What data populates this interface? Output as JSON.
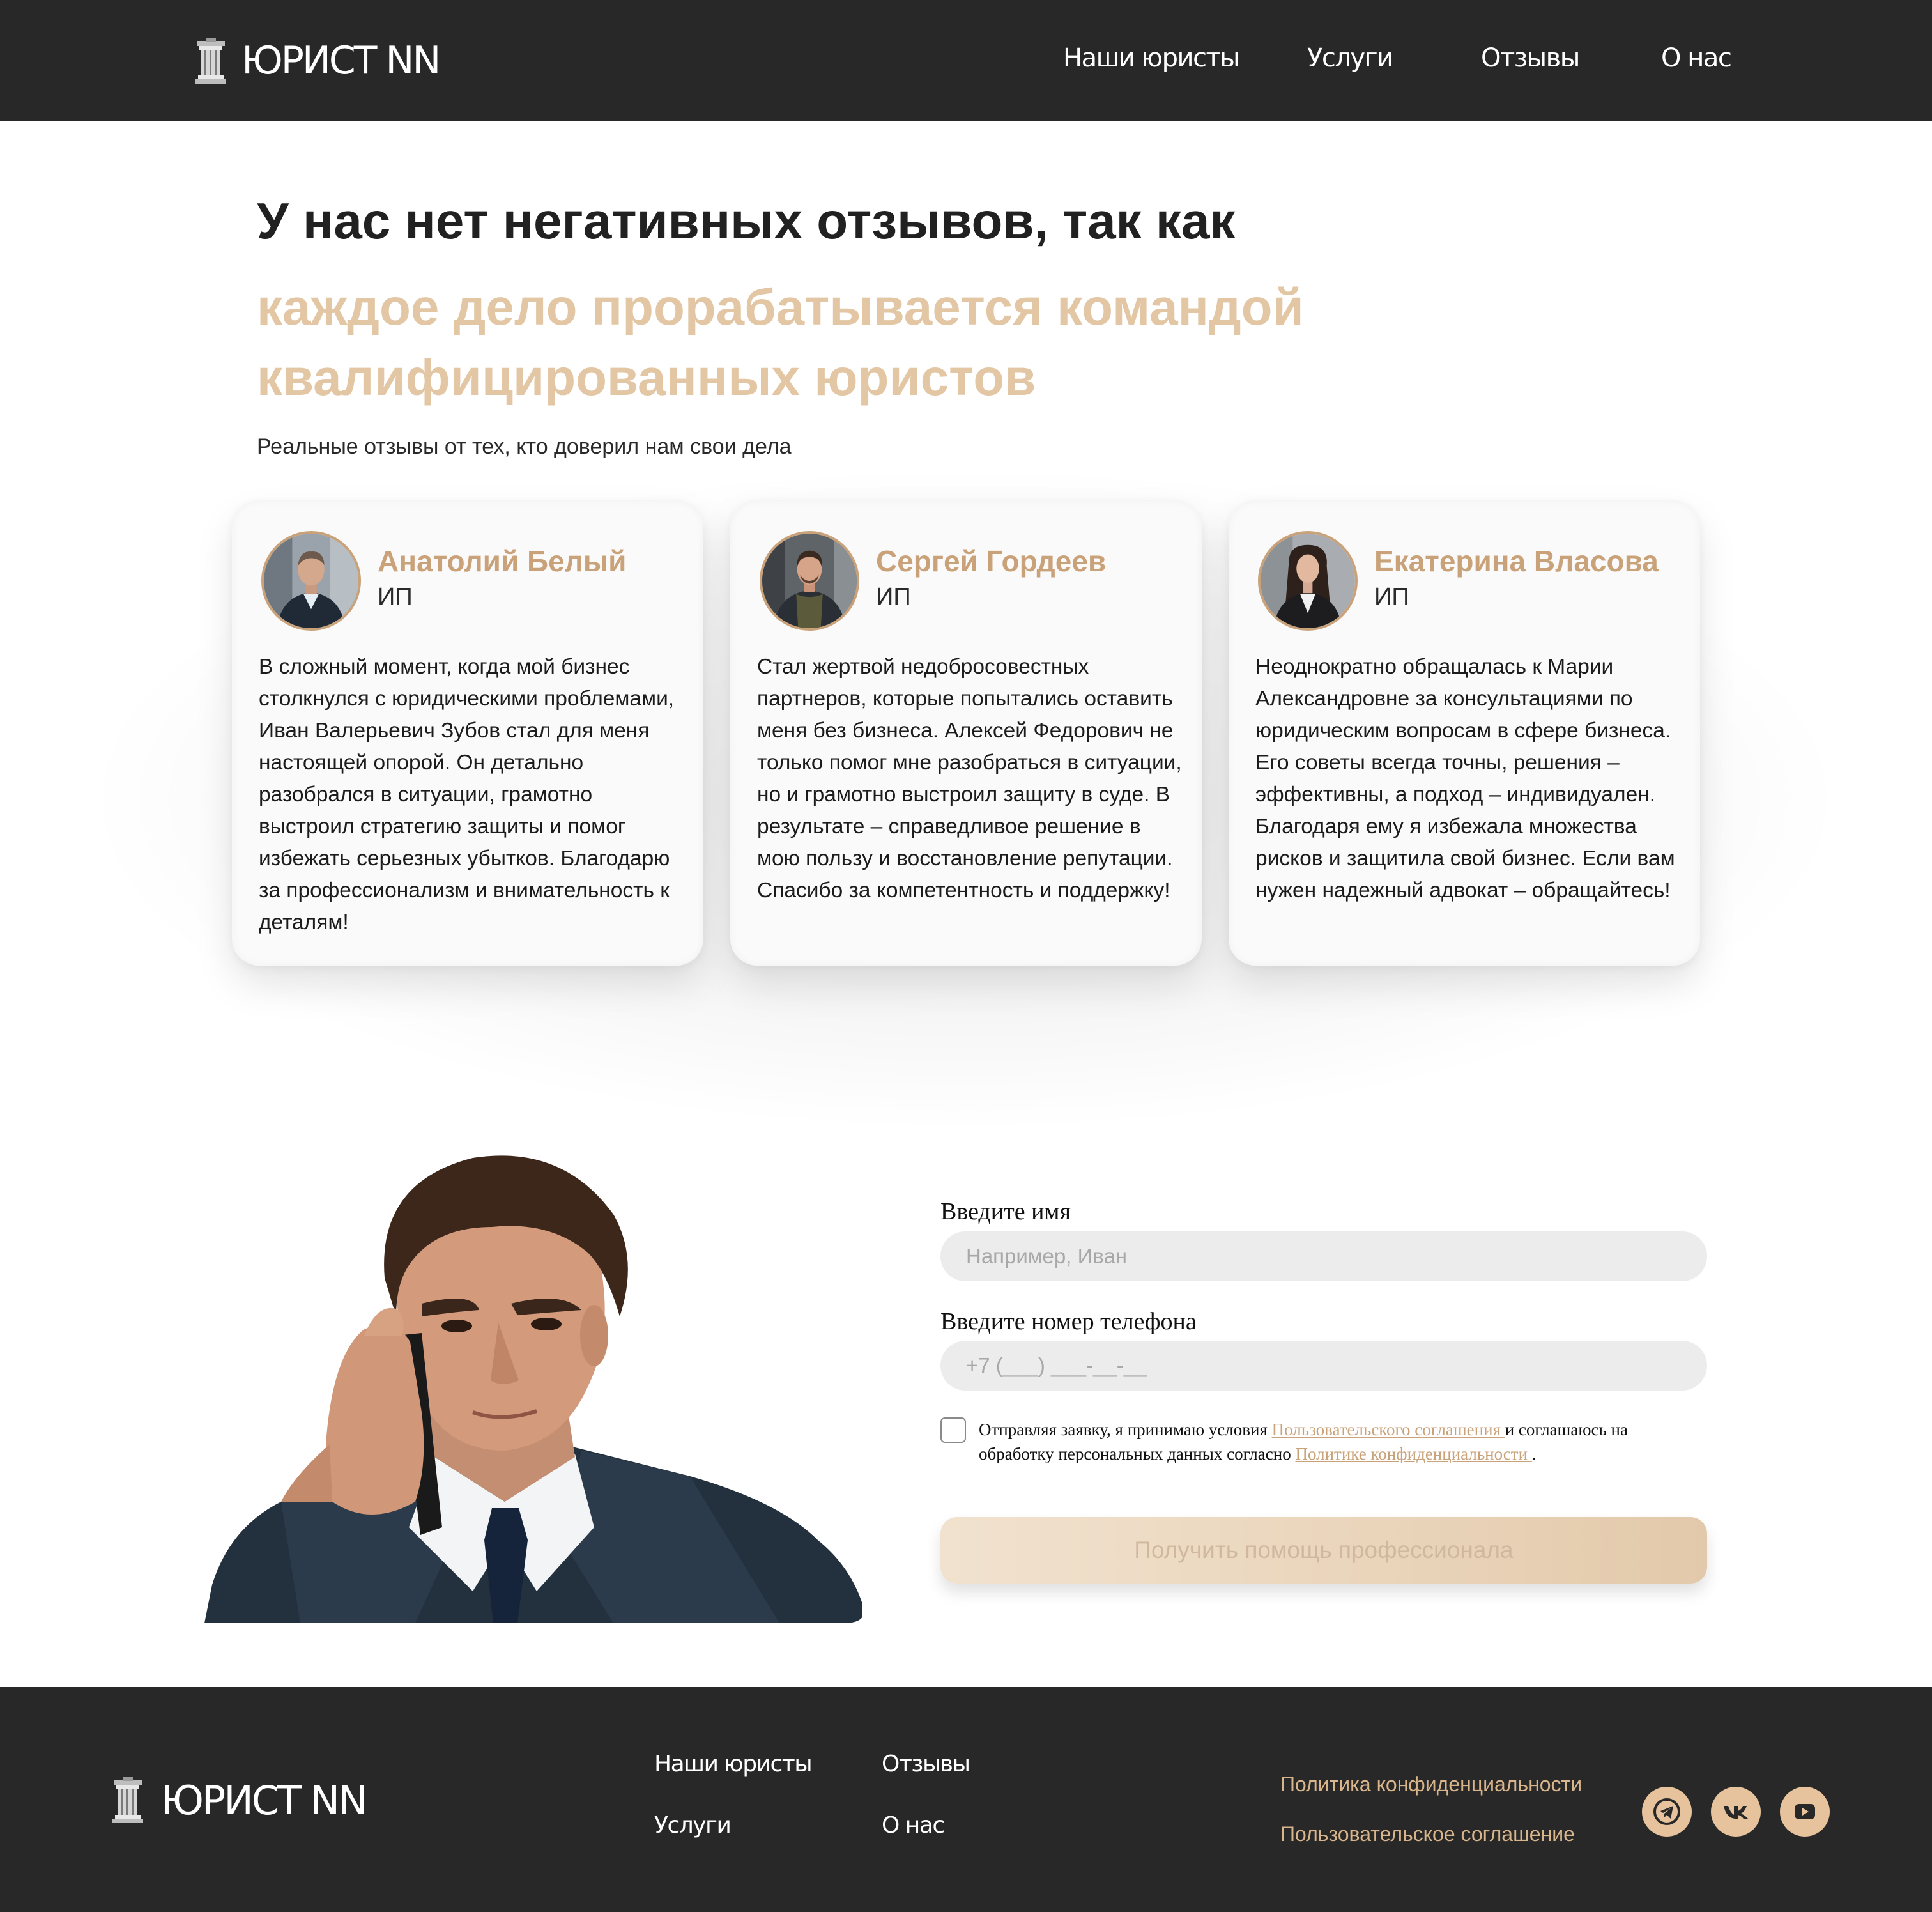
{
  "brand": {
    "name": "ЮРИСТ NN"
  },
  "nav": {
    "items": [
      {
        "label": "Наши юристы"
      },
      {
        "label": "Услуги"
      },
      {
        "label": "Отзывы"
      },
      {
        "label": "О нас"
      }
    ]
  },
  "hero": {
    "title_dark": "У нас нет негативных отзывов, так как",
    "title_gold": "каждое дело прорабатывается командой квалифицированных юристов",
    "subtitle": "Реальные отзывы от тех, кто доверил нам свои дела"
  },
  "reviews": [
    {
      "name": "Анатолий Белый",
      "role": "ИП",
      "text": "В сложный момент, когда мой бизнес столкнулся с юридическими проблемами, Иван Валерьевич Зубов стал для меня настоящей опорой. Он детально разобрался в ситуации, грамотно выстроил стратегию защиты и помог избежать серьезных убытков. Благодарю за профессионализм и внимательность к деталям!"
    },
    {
      "name": "Сергей Гордеев",
      "role": "ИП",
      "text": "Стал жертвой недобросовестных партнеров, которые попытались оставить меня без бизнеса. Алексей Федорович не только помог мне разобраться в ситуации, но и грамотно выстроил защиту в суде. В результате – справедливое решение в мою пользу и восстановление репутации. Спасибо за компетентность и поддержку!"
    },
    {
      "name": "Екатерина Власова",
      "role": "ИП",
      "text": "Неоднократно обращалась к Марии Александровне за консультациями по юридическим вопросам в сфере бизнеса. Его советы всегда точны, решения – эффективны, а подход – индивидуален. Благодаря ему я избежала множества рисков и защитила свой бизнес. Если вам нужен надежный адвокат – обращайтесь!"
    }
  ],
  "form": {
    "name_label": "Введите имя",
    "name_placeholder": "Например, Иван",
    "phone_label": "Введите номер телефона",
    "phone_placeholder": "+7 (___) ___-__-__",
    "consent_before": "Отправляя заявку, я принимаю условия ",
    "consent_link1": "Пользовательского соглашения ",
    "consent_middle": "и соглашаюсь на обработку персональных данных согласно ",
    "consent_link2": "Политике конфиденциальности ",
    "consent_after": ".",
    "submit_label": "Получить помощь профессионала"
  },
  "footer": {
    "links": [
      {
        "label": "Наши юристы"
      },
      {
        "label": "Отзывы"
      },
      {
        "label": "Услуги"
      },
      {
        "label": "О нас"
      }
    ],
    "privacy": "Политика конфиденциальности",
    "agreement": "Пользовательское соглашение",
    "social": [
      "telegram-icon",
      "vk-icon",
      "youtube-icon"
    ]
  },
  "colors": {
    "header_bg": "#282828",
    "accent_gold": "#c9a27a",
    "title_gold": "#e3c7a4",
    "social_bg": "#e7c39d"
  }
}
